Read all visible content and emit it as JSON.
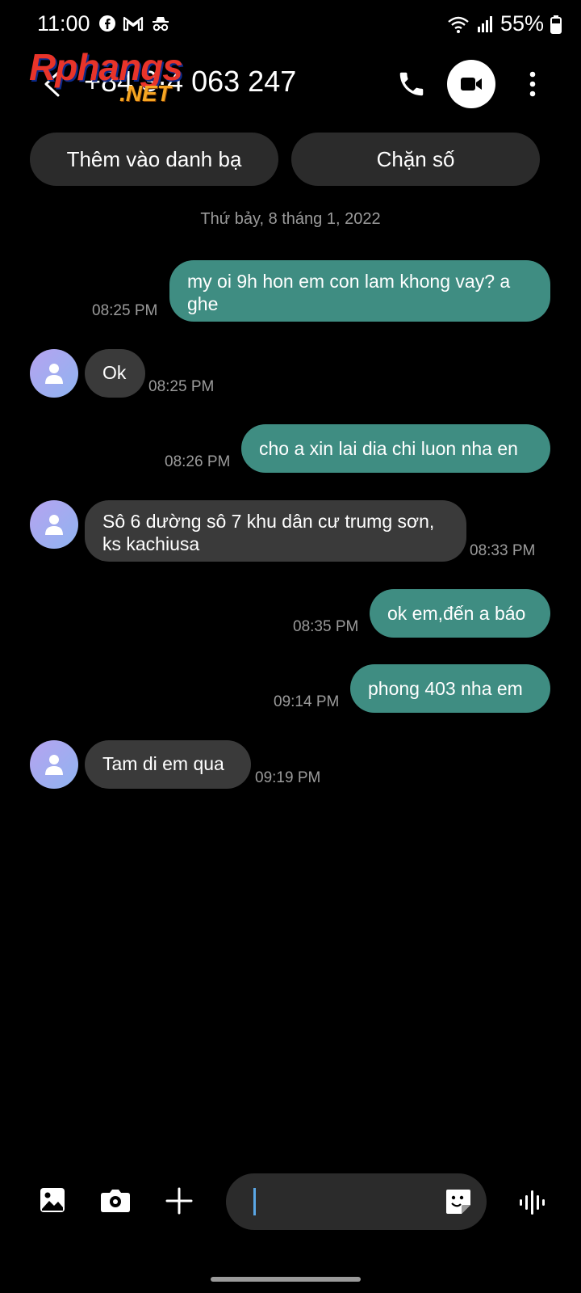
{
  "status_bar": {
    "time": "11:00",
    "notification_icons": [
      "facebook-icon",
      "gmail-icon",
      "incognito-icon"
    ],
    "battery": "55%",
    "network_icons": [
      "wifi-icon",
      "signal-icon",
      "battery-icon"
    ]
  },
  "header": {
    "contact_number": "+84 3·4 063 247",
    "actions": [
      "back-icon",
      "phone-icon",
      "video-call-icon",
      "more-vert-icon"
    ]
  },
  "watermark": {
    "line1": "Rphangs",
    "line2": ".NET"
  },
  "action_buttons": {
    "add_contact": "Thêm vào danh bạ",
    "block_number": "Chặn số"
  },
  "date_separator": "Thứ bảy, 8 tháng 1, 2022",
  "messages": [
    {
      "direction": "out",
      "lines": [
        "my oi 9h hon em con lam khong vay? a",
        "ghe"
      ],
      "time": "08:25 PM"
    },
    {
      "direction": "in",
      "lines": [
        "Ok"
      ],
      "time": "08:25 PM"
    },
    {
      "direction": "out",
      "lines": [
        "cho a xin lai dia chi luon nha en"
      ],
      "time": "08:26 PM"
    },
    {
      "direction": "in",
      "lines": [
        "Sô 6 dường sô 7 khu dân cư trumg sơn,",
        "ks kachiusa"
      ],
      "time": "08:33 PM"
    },
    {
      "direction": "out",
      "lines": [
        "ok em,đến a báo"
      ],
      "time": "08:35 PM"
    },
    {
      "direction": "out",
      "lines": [
        "phong 403 nha em"
      ],
      "time": "09:14 PM"
    },
    {
      "direction": "in",
      "lines": [
        "Tam di em qua"
      ],
      "time": "09:19 PM"
    }
  ],
  "composer": {
    "placeholder": "",
    "value": "",
    "icons": [
      "gallery-icon",
      "camera-icon",
      "plus-icon",
      "sticker-icon",
      "voice-icon"
    ]
  },
  "colors": {
    "background": "#000000",
    "outgoing_bubble": "#3f8d82",
    "incoming_bubble": "#3a3a3a",
    "button_bg": "#2b2b2b",
    "secondary_text": "#9b9b9b",
    "cursor": "#5aa7e6"
  }
}
